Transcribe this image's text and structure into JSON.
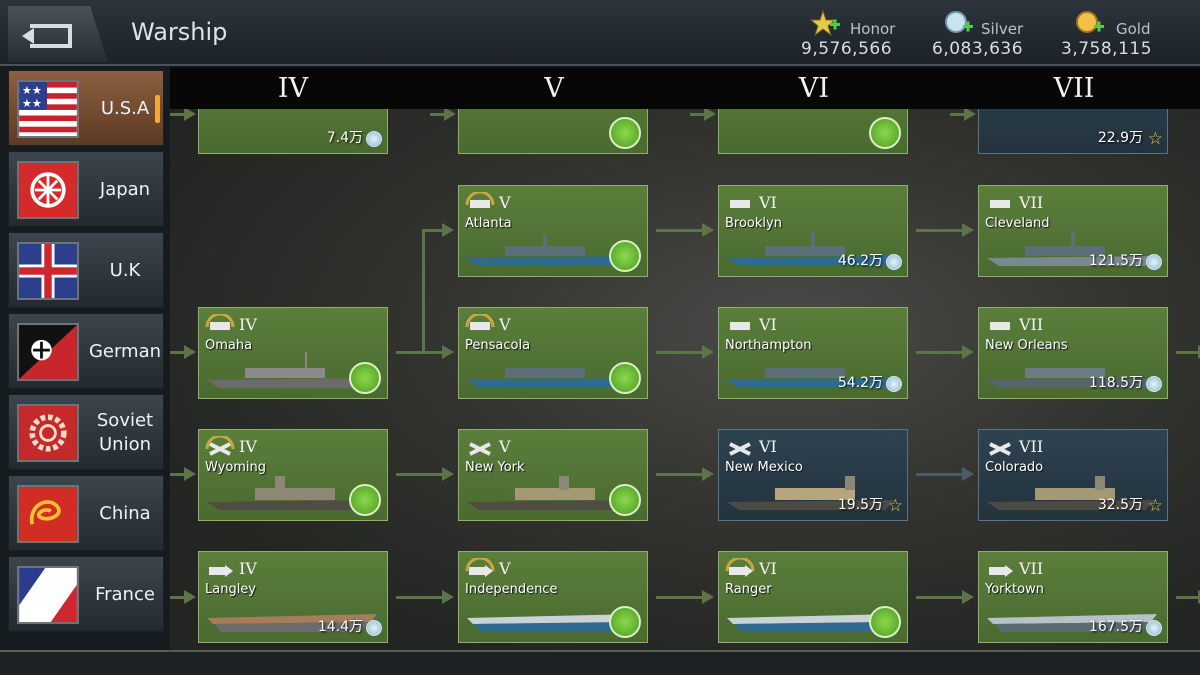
{
  "header": {
    "title": "Warship",
    "currencies": [
      {
        "label": "Honor",
        "amount": "9,576,566",
        "icon": "honor-star-icon"
      },
      {
        "label": "Silver",
        "amount": "6,083,636",
        "icon": "silver-coin-icon"
      },
      {
        "label": "Gold",
        "amount": "3,758,115",
        "icon": "gold-coin-icon"
      }
    ]
  },
  "nations": [
    {
      "label": "U.S.A",
      "active": true
    },
    {
      "label": "Japan"
    },
    {
      "label": "U.K"
    },
    {
      "label": "German"
    },
    {
      "label": "Soviet\nUnion"
    },
    {
      "label": "China"
    },
    {
      "label": "France"
    }
  ],
  "tiers": [
    "IV",
    "V",
    "VI",
    "VII"
  ],
  "ships": {
    "r0": [
      {
        "price": "7.4万",
        "status": "priced"
      },
      {
        "status": "owned"
      },
      {
        "status": "owned"
      },
      {
        "price": "22.9万",
        "status": "star"
      }
    ],
    "r1": [
      {
        "tier": "V",
        "name": "Atlanta",
        "status": "owned"
      },
      {
        "tier": "VI",
        "name": "Brooklyn",
        "price": "46.2万"
      },
      {
        "tier": "VII",
        "name": "Cleveland",
        "price": "121.5万"
      }
    ],
    "r2": [
      {
        "tier": "IV",
        "name": "Omaha",
        "status": "owned"
      },
      {
        "tier": "V",
        "name": "Pensacola",
        "status": "owned"
      },
      {
        "tier": "VI",
        "name": "Northampton",
        "price": "54.2万"
      },
      {
        "tier": "VII",
        "name": "New Orleans",
        "price": "118.5万"
      }
    ],
    "r3": [
      {
        "tier": "IV",
        "name": "Wyoming",
        "status": "owned"
      },
      {
        "tier": "V",
        "name": "New York",
        "status": "owned"
      },
      {
        "tier": "VI",
        "name": "New Mexico",
        "price": "19.5万"
      },
      {
        "tier": "VII",
        "name": "Colorado",
        "price": "32.5万"
      }
    ],
    "r4": [
      {
        "tier": "IV",
        "name": "Langley",
        "price": "14.4万"
      },
      {
        "tier": "V",
        "name": "Independence",
        "status": "owned"
      },
      {
        "tier": "VI",
        "name": "Ranger",
        "status": "owned"
      },
      {
        "tier": "VII",
        "name": "Yorktown",
        "price": "167.5万"
      }
    ]
  }
}
